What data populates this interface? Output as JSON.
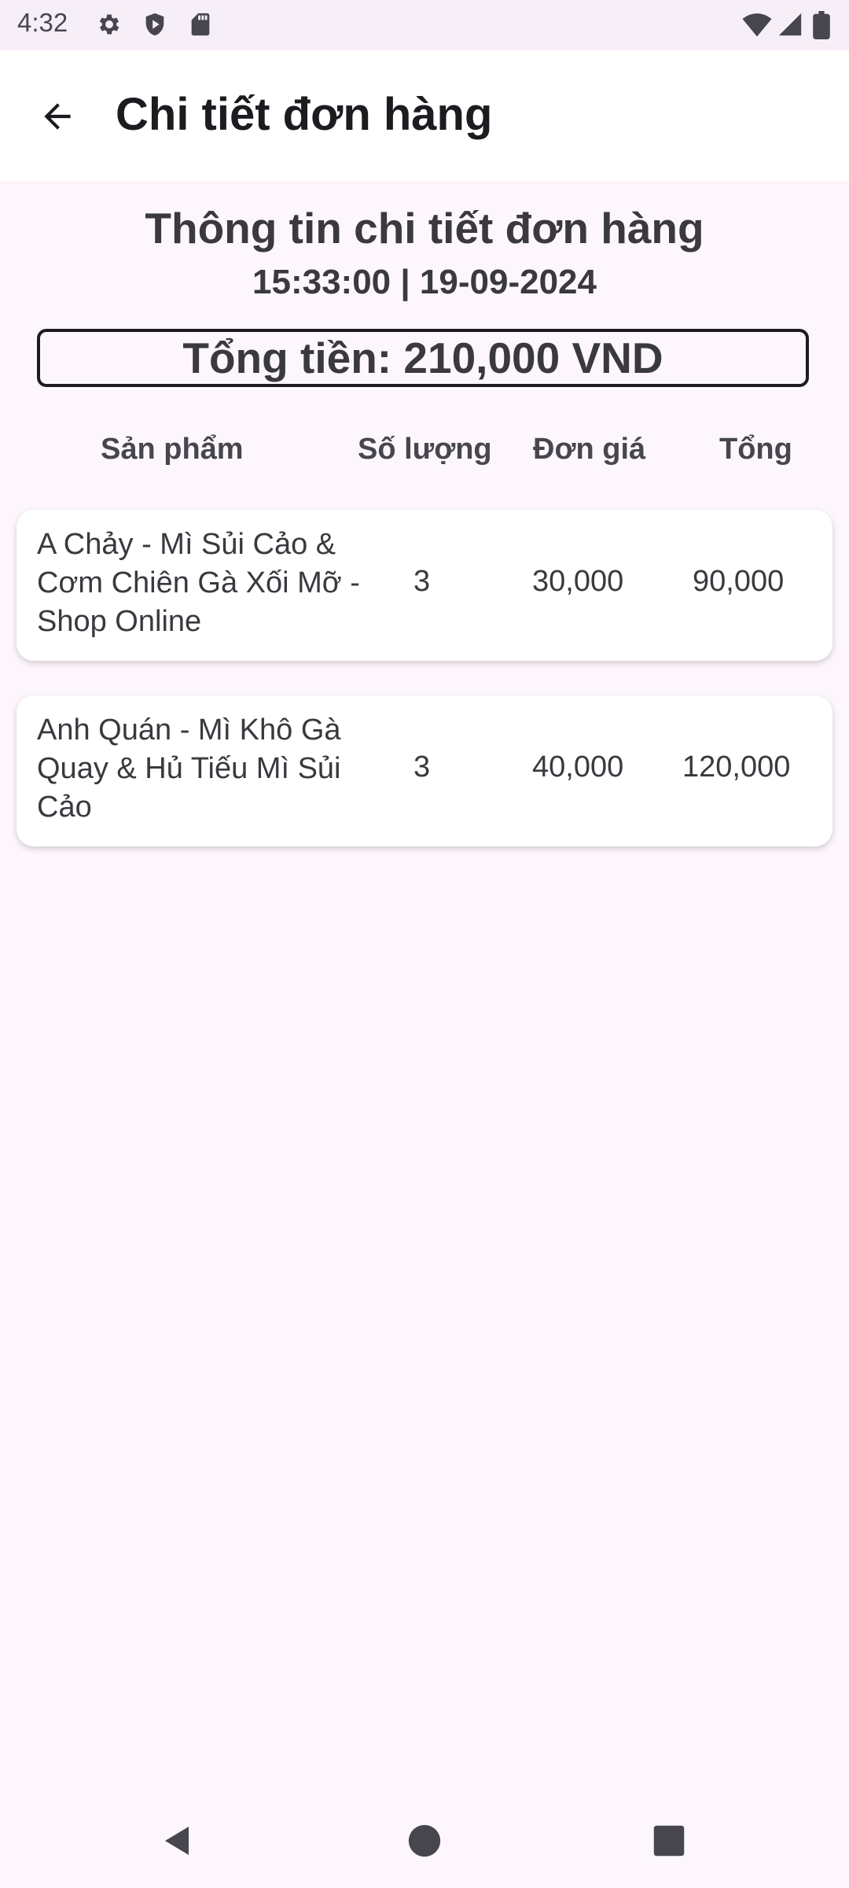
{
  "status_bar": {
    "time": "4:32",
    "left_icons": [
      "gear-icon",
      "shield-icon",
      "sd-card-icon"
    ],
    "right_icons": [
      "wifi-icon",
      "signal-icon",
      "battery-icon"
    ]
  },
  "app_bar": {
    "title": "Chi tiết đơn hàng",
    "back_icon": "arrow-back-icon"
  },
  "order": {
    "heading": "Thông tin chi tiết đơn hàng",
    "datetime": "15:33:00 | 19-09-2024",
    "total": "Tổng tiền: 210,000 VND"
  },
  "columns": {
    "product": "Sản phẩm",
    "quantity": "Số lượng",
    "unit_price": "Đơn giá",
    "total": "Tổng"
  },
  "items": [
    {
      "name": "A Chảy - Mì Sủi Cảo & Cơm Chiên Gà Xối Mỡ - Shop Online",
      "quantity": "3",
      "unit_price": "30,000",
      "total": "90,000"
    },
    {
      "name": "Anh Quán - Mì Khô Gà Quay & Hủ Tiếu Mì Sủi Cảo",
      "quantity": "3",
      "unit_price": "40,000",
      "total": "120,000"
    }
  ],
  "nav_bar": {
    "icons": [
      "nav-back-icon",
      "nav-home-icon",
      "nav-recents-icon"
    ]
  },
  "colors": {
    "background": "#fdf7fd",
    "status_bar": "#f7eff7",
    "card": "#ffffff",
    "text": "#3a393f"
  }
}
